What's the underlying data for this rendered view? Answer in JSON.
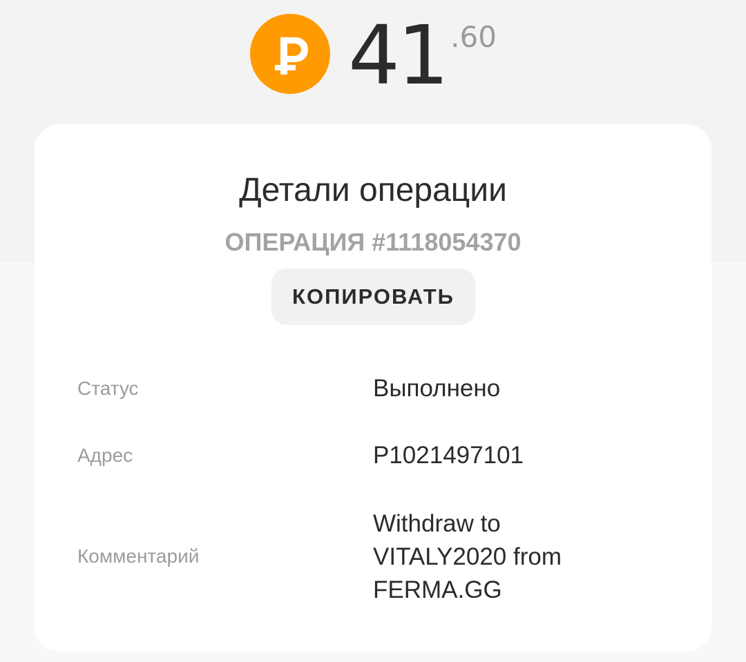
{
  "balance": {
    "currency_icon": "ruble-icon",
    "currency_color": "#ff9a00",
    "amount_integer": "41",
    "amount_fraction": ".60"
  },
  "card": {
    "title": "Детали операции",
    "operation_number": "ОПЕРАЦИЯ #1118054370",
    "copy_label": "КОПИРОВАТЬ",
    "details": {
      "status_label": "Статус",
      "status_value": "Выполнено",
      "address_label": "Адрес",
      "address_value": "P1021497101",
      "comment_label": "Комментарий",
      "comment_lines": [
        "Withdraw to",
        "VITALY2020 from",
        "FERMA.GG"
      ]
    }
  }
}
